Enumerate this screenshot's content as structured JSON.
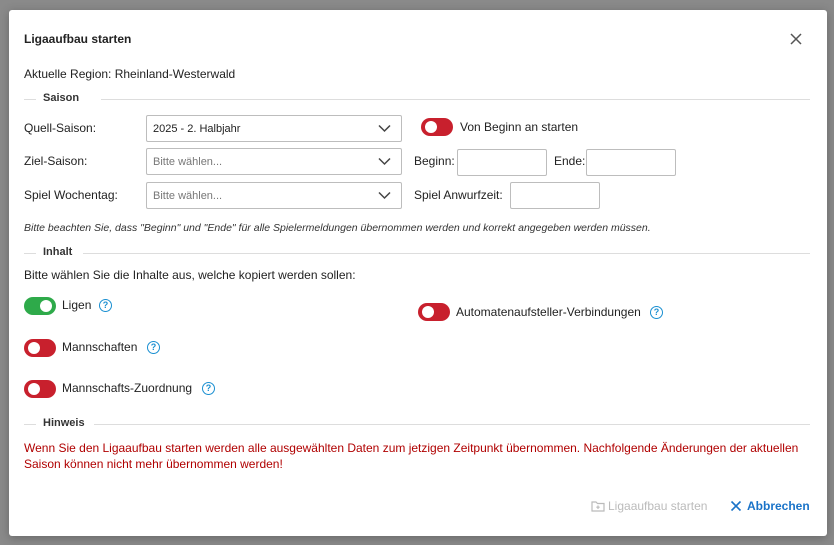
{
  "dialog": {
    "title": "Ligaaufbau starten",
    "region_text": "Aktuelle Region: Rheinland-Westerwald"
  },
  "saison": {
    "section_label": "Saison",
    "quell_label": "Quell-Saison:",
    "quell_value": "2025 - 2. Halbjahr",
    "ziel_label": "Ziel-Saison:",
    "ziel_placeholder": "Bitte wählen...",
    "wochentag_label": "Spiel Wochentag:",
    "wochentag_placeholder": "Bitte wählen...",
    "von_beginn_label": "Von Beginn an starten",
    "von_beginn_on": false,
    "beginn_label": "Beginn:",
    "beginn_value": "",
    "ende_label": "Ende:",
    "ende_value": "",
    "anwurfzeit_label": "Spiel Anwurfzeit:",
    "anwurfzeit_value": "",
    "note": "Bitte beachten Sie, dass \"Beginn\" und \"Ende\" für alle Spielermeldungen übernommen werden und korrekt angegeben werden müssen."
  },
  "inhalt": {
    "section_label": "Inhalt",
    "instruction": "Bitte wählen Sie die Inhalte aus, welche kopiert werden sollen:",
    "items": [
      {
        "label": "Ligen",
        "on": true
      },
      {
        "label": "Mannschaften",
        "on": false
      },
      {
        "label": "Mannschafts-Zuordnung",
        "on": false
      },
      {
        "label": "Automatenaufsteller-Verbindungen",
        "on": false
      }
    ]
  },
  "hinweis": {
    "section_label": "Hinweis",
    "text": "Wenn Sie den Ligaaufbau starten werden alle ausgewählten Daten zum jetzigen Zeitpunkt übernommen. Nachfolgende Änderungen der aktuellen Saison können nicht mehr übernommen werden!"
  },
  "footer": {
    "start_label": "Ligaaufbau starten",
    "cancel_label": "Abbrechen"
  },
  "colors": {
    "toggle_off": "#c8202d",
    "toggle_on": "#2eaa4a",
    "help": "#1a8fd1",
    "warning": "#b00000",
    "link": "#1a73c8"
  }
}
